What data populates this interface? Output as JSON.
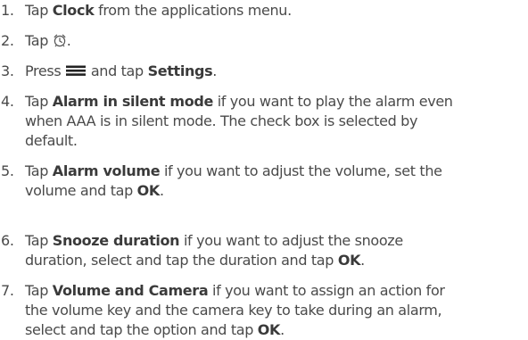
{
  "steps": [
    {
      "number": "1.",
      "lines": [
        [
          {
            "text": "Tap ",
            "bold": false
          },
          {
            "text": "Clock",
            "bold": true
          },
          {
            "text": " from the applications menu.",
            "bold": false
          }
        ]
      ]
    },
    {
      "number": "2.",
      "lines": [
        [
          {
            "text": "Tap ",
            "bold": false
          },
          {
            "icon": "alarm-clock-icon"
          },
          {
            "text": ".",
            "bold": false
          }
        ]
      ]
    },
    {
      "number": "3.",
      "lines": [
        [
          {
            "text": "Press ",
            "bold": false
          },
          {
            "icon": "menu-icon"
          },
          {
            "text": " and tap ",
            "bold": false
          },
          {
            "text": "Settings",
            "bold": true
          },
          {
            "text": ".",
            "bold": false
          }
        ]
      ]
    },
    {
      "number": "4.",
      "lines": [
        [
          {
            "text": "Tap ",
            "bold": false
          },
          {
            "text": "Alarm in silent mode",
            "bold": true
          },
          {
            "text": " if you want to play the alarm even",
            "bold": false
          }
        ],
        [
          {
            "text": "when AAA is in silent mode. The check box is selected by",
            "bold": false
          }
        ],
        [
          {
            "text": "default.",
            "bold": false
          }
        ]
      ]
    },
    {
      "number": "5.",
      "lines": [
        [
          {
            "text": "Tap ",
            "bold": false
          },
          {
            "text": "Alarm volume",
            "bold": true
          },
          {
            "text": " if you want to adjust the volume, set the",
            "bold": false
          }
        ],
        [
          {
            "text": "volume and tap ",
            "bold": false
          },
          {
            "text": "OK",
            "bold": true
          },
          {
            "text": ".",
            "bold": false
          }
        ]
      ]
    },
    {
      "number": "6.",
      "lines": [
        [
          {
            "text": "Tap ",
            "bold": false
          },
          {
            "text": "Snooze duration",
            "bold": true
          },
          {
            "text": " if you want to adjust the snooze",
            "bold": false
          }
        ],
        [
          {
            "text": "duration, select and tap the duration and tap ",
            "bold": false
          },
          {
            "text": "OK",
            "bold": true
          },
          {
            "text": ".",
            "bold": false
          }
        ]
      ]
    },
    {
      "number": "7.",
      "lines": [
        [
          {
            "text": "Tap ",
            "bold": false
          },
          {
            "text": "Volume and Camera",
            "bold": true
          },
          {
            "text": " if you want to assign an action for",
            "bold": false
          }
        ],
        [
          {
            "text": "the volume key and the camera key to take during an alarm,",
            "bold": false
          }
        ],
        [
          {
            "text": "select and tap the option and tap ",
            "bold": false
          },
          {
            "text": "OK",
            "bold": true
          },
          {
            "text": ".",
            "bold": false
          }
        ]
      ]
    }
  ]
}
